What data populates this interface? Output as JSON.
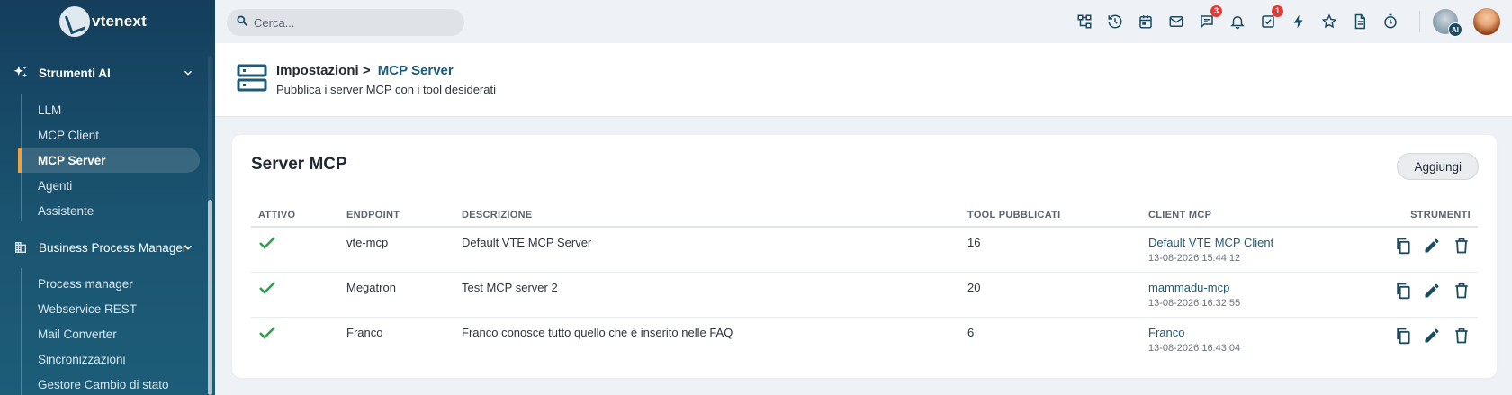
{
  "app": {
    "logo_text": "vtenext"
  },
  "search": {
    "placeholder": "Cerca..."
  },
  "topbar": {
    "icons": [
      "sitemap-icon",
      "history-icon",
      "calendar-icon",
      "mail-icon",
      "chat-icon",
      "bell-icon",
      "tasks-icon",
      "bolt-icon",
      "star-icon",
      "document-icon",
      "timer-icon"
    ],
    "chat_badge": "3",
    "tasks_badge": "1",
    "ai_tag": "AI"
  },
  "sidebar": {
    "sections": [
      {
        "label": "Strumenti AI",
        "items": [
          "LLM",
          "MCP Client",
          "MCP Server",
          "Agenti",
          "Assistente"
        ],
        "active": "MCP Server"
      },
      {
        "label": "Business Process Manager",
        "items": [
          "Process manager",
          "Webservice REST",
          "Mail Converter",
          "Sincronizzazioni",
          "Gestore Cambio di stato"
        ]
      }
    ]
  },
  "page_header": {
    "crumb_parent": "Impostazioni >",
    "crumb_current": "MCP Server",
    "subtitle": "Pubblica i server MCP con i tool desiderati"
  },
  "card": {
    "title": "Server MCP",
    "add_button": "Aggiungi",
    "columns": [
      "ATTIVO",
      "ENDPOINT",
      "DESCRIZIONE",
      "TOOL PUBBLICATI",
      "CLIENT MCP",
      "STRUMENTI"
    ],
    "rows": [
      {
        "active": true,
        "endpoint": "vte-mcp",
        "description": "Default VTE MCP Server",
        "tools": "16",
        "client": "Default VTE MCP Client",
        "timestamp": "13-08-2026 15:44:12"
      },
      {
        "active": true,
        "endpoint": "Megatron",
        "description": "Test MCP server 2",
        "tools": "20",
        "client": "mammadu-mcp",
        "timestamp": "13-08-2026 16:32:55"
      },
      {
        "active": true,
        "endpoint": "Franco",
        "description": "Franco conosce tutto quello che è inserito nelle FAQ",
        "tools": "6",
        "client": "Franco",
        "timestamp": "13-08-2026 16:43:04"
      }
    ]
  },
  "colors": {
    "accent": "#1d5a76",
    "active_marker": "#f2a23a",
    "check": "#2e9e4f",
    "badge": "#e53935"
  }
}
